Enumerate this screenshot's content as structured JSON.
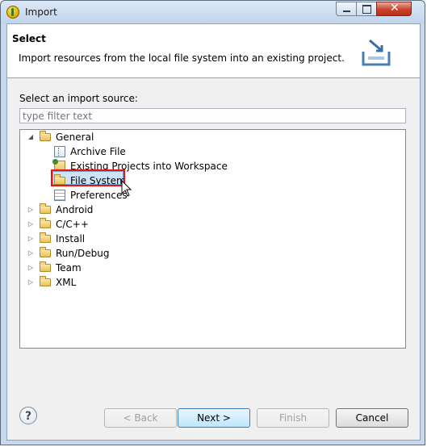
{
  "window": {
    "title": "Import"
  },
  "banner": {
    "title": "Select",
    "description": "Import resources from the local file system into an existing project."
  },
  "source": {
    "label": "Select an import source:",
    "filter_placeholder": "type filter text"
  },
  "tree": {
    "general": {
      "label": "General",
      "children": [
        "Archive File",
        "Existing Projects into Workspace",
        "File System",
        "Preferences"
      ],
      "selected": "File System"
    },
    "collapsed": [
      "Android",
      "C/C++",
      "Install",
      "Run/Debug",
      "Team",
      "XML"
    ]
  },
  "buttons": {
    "help": "?",
    "back": "< Back",
    "next": "Next >",
    "finish": "Finish",
    "cancel": "Cancel"
  },
  "colors": {
    "selection_highlight": "#e11111",
    "titlebar": "#c2d5ec",
    "close_button": "#c8422b"
  },
  "icons": [
    "app-icon",
    "minimize-icon",
    "maximize-icon",
    "close-icon",
    "import-icon",
    "folder-icon",
    "archive-file-icon",
    "project-icon",
    "file-system-folder-icon",
    "preferences-icon",
    "expand-arrow-icon",
    "help-icon",
    "mouse-cursor-icon"
  ]
}
